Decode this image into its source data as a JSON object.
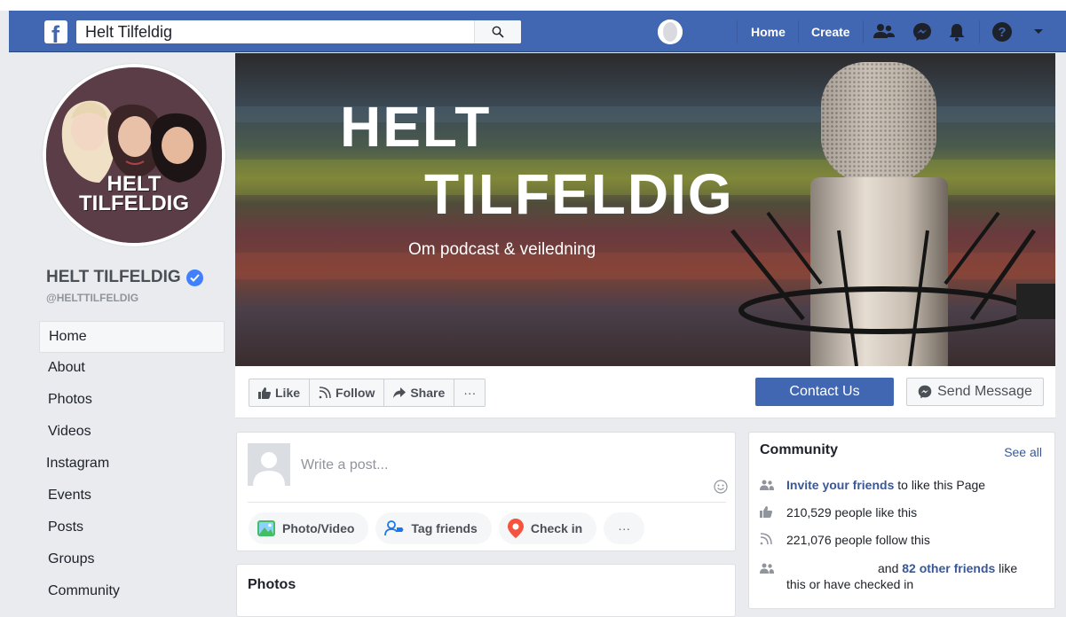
{
  "topbar": {
    "search_value": "Helt Tilfeldig",
    "logo_letter": "f",
    "nav_home": "Home",
    "nav_create": "Create"
  },
  "sidebar": {
    "page_name": "HELT TILFELDIG",
    "handle": "@HELTTILFELDIG",
    "profile_text_1": "HELT",
    "profile_text_2": "TILFELDIG",
    "items": [
      "Home",
      "About",
      "Photos",
      "Videos",
      "Instagram",
      "Events",
      "Posts",
      "Groups",
      "Community"
    ]
  },
  "cover": {
    "title_line1": "HELT",
    "title_line2": "TILFELDIG",
    "subtitle": "Om podcast & veiledning"
  },
  "actions": {
    "like": "Like",
    "follow": "Follow",
    "share": "Share",
    "more": "···",
    "contact": "Contact Us",
    "send_message": "Send Message"
  },
  "composer": {
    "placeholder": "Write a post...",
    "photo_video": "Photo/Video",
    "tag_friends": "Tag friends",
    "check_in": "Check in",
    "more": "···"
  },
  "photos": {
    "title": "Photos"
  },
  "community": {
    "title": "Community",
    "see_all": "See all",
    "invite_link": "Invite your friends",
    "invite_rest": " to like this Page",
    "likes_text": "210,529 people like this",
    "follows_text": "221,076 people follow this",
    "friends_and": "and ",
    "friends_link": "82 other friends",
    "friends_rest": " like this or have checked in"
  },
  "colors": {
    "fb_blue": "#4267b2",
    "link_blue": "#385898",
    "verified_blue": "#4080ff",
    "background": "#e9ebee"
  }
}
